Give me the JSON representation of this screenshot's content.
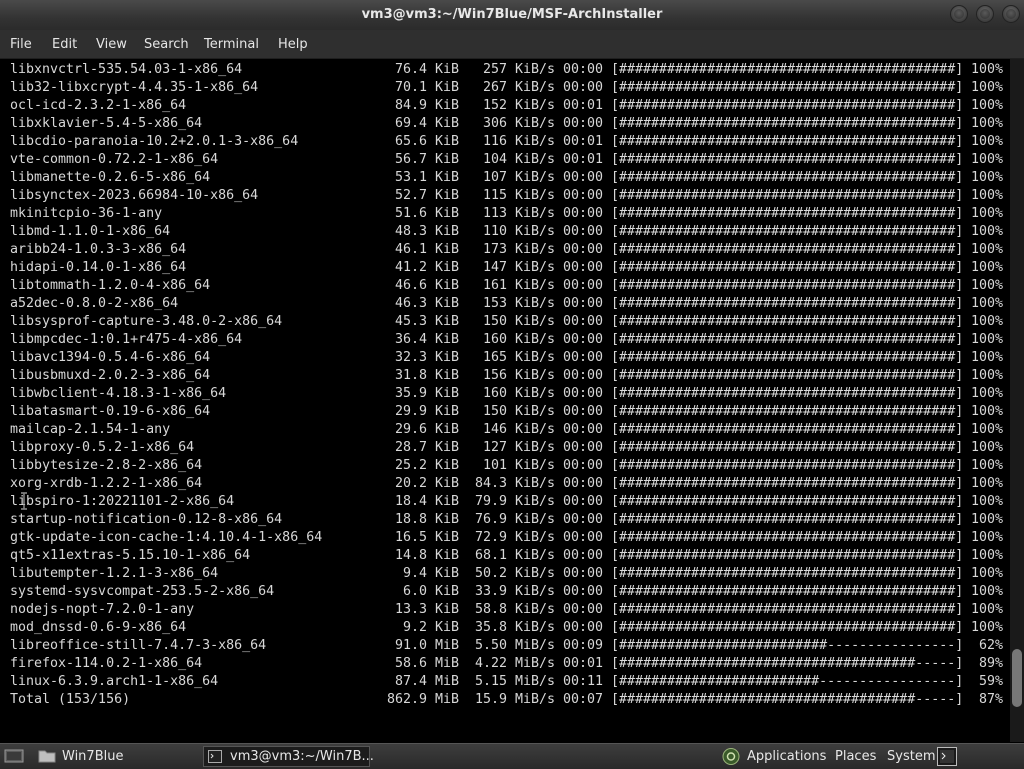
{
  "window": {
    "title": "vm3@vm3:~/Win7Blue/MSF-ArchInstaller"
  },
  "menu": [
    "File",
    "Edit",
    "View",
    "Search",
    "Terminal",
    "Help"
  ],
  "packages": [
    {
      "name": "libxnvctrl-535.54.03-1-x86_64",
      "size": "76.4",
      "unit": "KiB",
      "speed": "257",
      "speed_unit": "KiB/s",
      "time": "00:00",
      "percent": 100
    },
    {
      "name": "lib32-libxcrypt-4.4.35-1-x86_64",
      "size": "70.1",
      "unit": "KiB",
      "speed": "267",
      "speed_unit": "KiB/s",
      "time": "00:00",
      "percent": 100
    },
    {
      "name": "ocl-icd-2.3.2-1-x86_64",
      "size": "84.9",
      "unit": "KiB",
      "speed": "152",
      "speed_unit": "KiB/s",
      "time": "00:01",
      "percent": 100
    },
    {
      "name": "libxklavier-5.4-5-x86_64",
      "size": "69.4",
      "unit": "KiB",
      "speed": "306",
      "speed_unit": "KiB/s",
      "time": "00:00",
      "percent": 100
    },
    {
      "name": "libcdio-paranoia-10.2+2.0.1-3-x86_64",
      "size": "65.6",
      "unit": "KiB",
      "speed": "116",
      "speed_unit": "KiB/s",
      "time": "00:01",
      "percent": 100
    },
    {
      "name": "vte-common-0.72.2-1-x86_64",
      "size": "56.7",
      "unit": "KiB",
      "speed": "104",
      "speed_unit": "KiB/s",
      "time": "00:01",
      "percent": 100
    },
    {
      "name": "libmanette-0.2.6-5-x86_64",
      "size": "53.1",
      "unit": "KiB",
      "speed": "107",
      "speed_unit": "KiB/s",
      "time": "00:00",
      "percent": 100
    },
    {
      "name": "libsynctex-2023.66984-10-x86_64",
      "size": "52.7",
      "unit": "KiB",
      "speed": "115",
      "speed_unit": "KiB/s",
      "time": "00:00",
      "percent": 100
    },
    {
      "name": "mkinitcpio-36-1-any",
      "size": "51.6",
      "unit": "KiB",
      "speed": "113",
      "speed_unit": "KiB/s",
      "time": "00:00",
      "percent": 100
    },
    {
      "name": "libmd-1.1.0-1-x86_64",
      "size": "48.3",
      "unit": "KiB",
      "speed": "110",
      "speed_unit": "KiB/s",
      "time": "00:00",
      "percent": 100
    },
    {
      "name": "aribb24-1.0.3-3-x86_64",
      "size": "46.1",
      "unit": "KiB",
      "speed": "173",
      "speed_unit": "KiB/s",
      "time": "00:00",
      "percent": 100
    },
    {
      "name": "hidapi-0.14.0-1-x86_64",
      "size": "41.2",
      "unit": "KiB",
      "speed": "147",
      "speed_unit": "KiB/s",
      "time": "00:00",
      "percent": 100
    },
    {
      "name": "libtommath-1.2.0-4-x86_64",
      "size": "46.6",
      "unit": "KiB",
      "speed": "161",
      "speed_unit": "KiB/s",
      "time": "00:00",
      "percent": 100
    },
    {
      "name": "a52dec-0.8.0-2-x86_64",
      "size": "46.3",
      "unit": "KiB",
      "speed": "153",
      "speed_unit": "KiB/s",
      "time": "00:00",
      "percent": 100
    },
    {
      "name": "libsysprof-capture-3.48.0-2-x86_64",
      "size": "45.3",
      "unit": "KiB",
      "speed": "150",
      "speed_unit": "KiB/s",
      "time": "00:00",
      "percent": 100
    },
    {
      "name": "libmpcdec-1:0.1+r475-4-x86_64",
      "size": "36.4",
      "unit": "KiB",
      "speed": "160",
      "speed_unit": "KiB/s",
      "time": "00:00",
      "percent": 100
    },
    {
      "name": "libavc1394-0.5.4-6-x86_64",
      "size": "32.3",
      "unit": "KiB",
      "speed": "165",
      "speed_unit": "KiB/s",
      "time": "00:00",
      "percent": 100
    },
    {
      "name": "libusbmuxd-2.0.2-3-x86_64",
      "size": "31.8",
      "unit": "KiB",
      "speed": "156",
      "speed_unit": "KiB/s",
      "time": "00:00",
      "percent": 100
    },
    {
      "name": "libwbclient-4.18.3-1-x86_64",
      "size": "35.9",
      "unit": "KiB",
      "speed": "160",
      "speed_unit": "KiB/s",
      "time": "00:00",
      "percent": 100
    },
    {
      "name": "libatasmart-0.19-6-x86_64",
      "size": "29.9",
      "unit": "KiB",
      "speed": "150",
      "speed_unit": "KiB/s",
      "time": "00:00",
      "percent": 100
    },
    {
      "name": "mailcap-2.1.54-1-any",
      "size": "29.6",
      "unit": "KiB",
      "speed": "146",
      "speed_unit": "KiB/s",
      "time": "00:00",
      "percent": 100
    },
    {
      "name": "libproxy-0.5.2-1-x86_64",
      "size": "28.7",
      "unit": "KiB",
      "speed": "127",
      "speed_unit": "KiB/s",
      "time": "00:00",
      "percent": 100
    },
    {
      "name": "libbytesize-2.8-2-x86_64",
      "size": "25.2",
      "unit": "KiB",
      "speed": "101",
      "speed_unit": "KiB/s",
      "time": "00:00",
      "percent": 100
    },
    {
      "name": "xorg-xrdb-1.2.2-1-x86_64",
      "size": "20.2",
      "unit": "KiB",
      "speed": "84.3",
      "speed_unit": "KiB/s",
      "time": "00:00",
      "percent": 100
    },
    {
      "name": "libspiro-1:20221101-2-x86_64",
      "size": "18.4",
      "unit": "KiB",
      "speed": "79.9",
      "speed_unit": "KiB/s",
      "time": "00:00",
      "percent": 100
    },
    {
      "name": "startup-notification-0.12-8-x86_64",
      "size": "18.8",
      "unit": "KiB",
      "speed": "76.9",
      "speed_unit": "KiB/s",
      "time": "00:00",
      "percent": 100
    },
    {
      "name": "gtk-update-icon-cache-1:4.10.4-1-x86_64",
      "size": "16.5",
      "unit": "KiB",
      "speed": "72.9",
      "speed_unit": "KiB/s",
      "time": "00:00",
      "percent": 100
    },
    {
      "name": "qt5-x11extras-5.15.10-1-x86_64",
      "size": "14.8",
      "unit": "KiB",
      "speed": "68.1",
      "speed_unit": "KiB/s",
      "time": "00:00",
      "percent": 100
    },
    {
      "name": "libutempter-1.2.1-3-x86_64",
      "size": "9.4",
      "unit": "KiB",
      "speed": "50.2",
      "speed_unit": "KiB/s",
      "time": "00:00",
      "percent": 100
    },
    {
      "name": "systemd-sysvcompat-253.5-2-x86_64",
      "size": "6.0",
      "unit": "KiB",
      "speed": "33.9",
      "speed_unit": "KiB/s",
      "time": "00:00",
      "percent": 100
    },
    {
      "name": "nodejs-nopt-7.2.0-1-any",
      "size": "13.3",
      "unit": "KiB",
      "speed": "58.8",
      "speed_unit": "KiB/s",
      "time": "00:00",
      "percent": 100
    },
    {
      "name": "mod_dnssd-0.6-9-x86_64",
      "size": "9.2",
      "unit": "KiB",
      "speed": "35.8",
      "speed_unit": "KiB/s",
      "time": "00:00",
      "percent": 100
    },
    {
      "name": "libreoffice-still-7.4.7-3-x86_64",
      "size": "91.0",
      "unit": "MiB",
      "speed": "5.50",
      "speed_unit": "MiB/s",
      "time": "00:09",
      "percent": 62
    },
    {
      "name": "firefox-114.0.2-1-x86_64",
      "size": "58.6",
      "unit": "MiB",
      "speed": "4.22",
      "speed_unit": "MiB/s",
      "time": "00:01",
      "percent": 89
    },
    {
      "name": "linux-6.3.9.arch1-1-x86_64",
      "size": "87.4",
      "unit": "MiB",
      "speed": "5.15",
      "speed_unit": "MiB/s",
      "time": "00:11",
      "percent": 59
    },
    {
      "name": "Total (153/156)",
      "size": "862.9",
      "unit": "MiB",
      "speed": "15.9",
      "speed_unit": "MiB/s",
      "time": "00:07",
      "percent": 87
    }
  ],
  "scroll_position": 0.95,
  "taskbar": {
    "desktop_label": "Win7Blue",
    "task_label": "vm3@vm3:~/Win7B...",
    "applications": "Applications",
    "places": "Places",
    "system": "System"
  }
}
